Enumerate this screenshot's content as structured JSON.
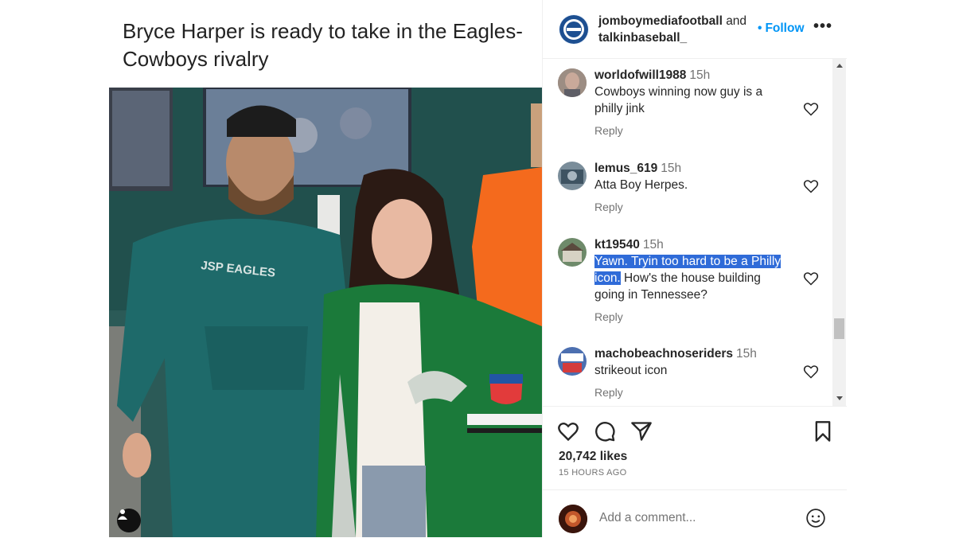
{
  "post": {
    "headline": "Bryce Harper is ready to take in the Eagles-Cowboys rivalry"
  },
  "header": {
    "user1": "jomboymediafootball",
    "and": "and",
    "user2": "talkinbaseball_",
    "follow_label": "Follow",
    "more_icon": "more-options-icon"
  },
  "comments": [
    {
      "user": "worldofwill1988",
      "time": "15h",
      "text": "Cowboys winning now guy is a philly jink",
      "reply": "Reply"
    },
    {
      "user": "lemus_619",
      "time": "15h",
      "text": "Atta Boy Herpes.",
      "reply": "Reply"
    },
    {
      "user": "kt19540",
      "time": "15h",
      "text_highlighted": "Yawn. Tryin too hard to be a Philly icon.",
      "text_rest": " How's the house building going in Tennessee?",
      "reply": "Reply"
    },
    {
      "user": "machobeachnoseriders",
      "time": "15h",
      "text": "strikeout icon",
      "reply": "Reply"
    }
  ],
  "stats": {
    "likes": "20,742 likes",
    "time_ago": "15 HOURS AGO"
  },
  "composer": {
    "placeholder": "Add a comment..."
  },
  "colors": {
    "accent": "#0095f6",
    "highlight": "#2f6bd8",
    "jersey_green": "#1b7a3a"
  }
}
